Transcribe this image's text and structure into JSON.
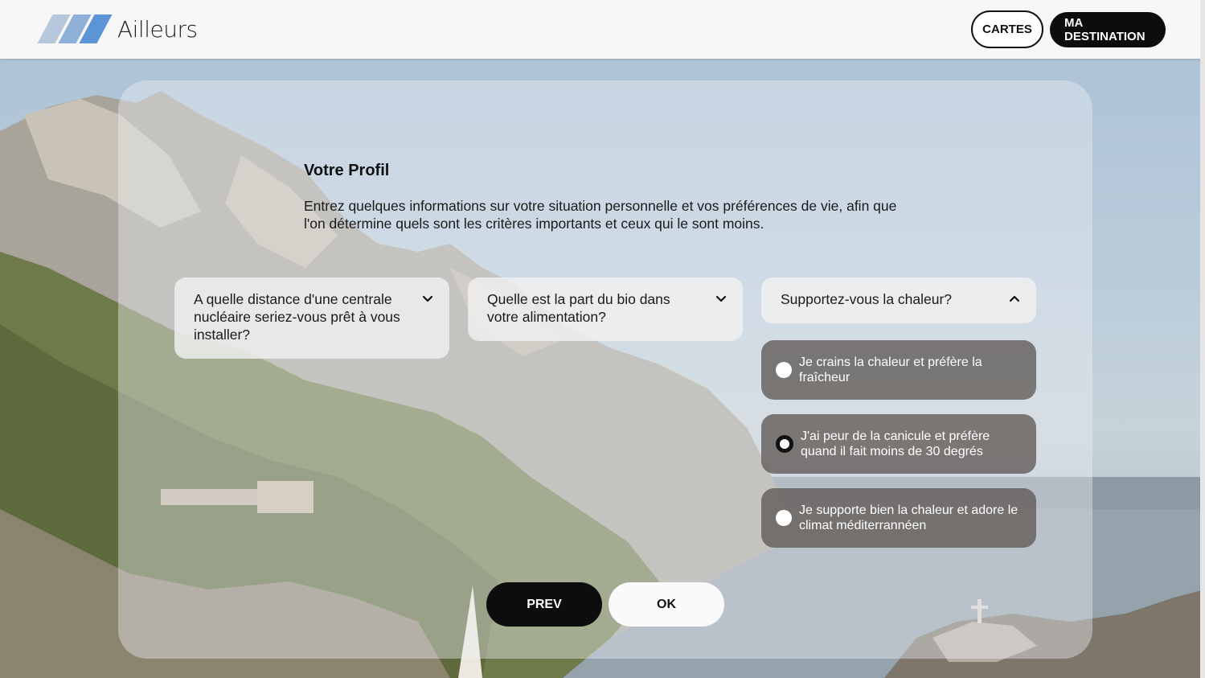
{
  "brand": {
    "name": "Ailleurs",
    "stripe_colors": [
      "#b8c8dc",
      "#8fb1d9",
      "#5b95d6"
    ]
  },
  "nav": {
    "cartes": "CARTES",
    "destination": "MA DESTINATION"
  },
  "profile": {
    "title": "Votre Profil",
    "intro": "Entrez quelques informations sur votre situation personnelle et vos préférences de vie, afin que l'on détermine quels sont les critères importants et ceux qui le sont moins."
  },
  "questions": [
    {
      "label": "A quelle distance d'une centrale nucléaire seriez-vous prêt à vous installer?",
      "expanded": false,
      "icon": "chevron-down-icon"
    },
    {
      "label": "Quelle est la part du bio dans votre alimentation?",
      "expanded": false,
      "icon": "chevron-down-icon"
    },
    {
      "label": "Supportez-vous la chaleur?",
      "expanded": true,
      "icon": "chevron-up-icon"
    }
  ],
  "heat_options": [
    {
      "label": "Je crains la chaleur et préfère la fraîcheur",
      "selected": false
    },
    {
      "label": "J'ai peur de la canicule et préfère quand il fait moins de 30 degrés",
      "selected": true
    },
    {
      "label": "Je supporte bien la chaleur et adore le climat méditerrannéen",
      "selected": false
    }
  ],
  "actions": {
    "prev": "PREV",
    "ok": "OK"
  }
}
